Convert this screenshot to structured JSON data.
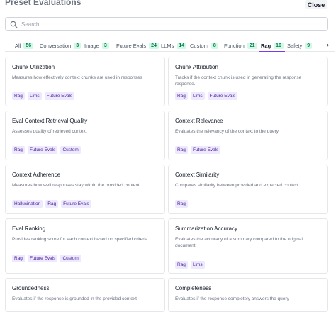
{
  "header": {
    "title": "Preset Evaluations",
    "close_label": "Close"
  },
  "search": {
    "placeholder": "Search",
    "value": ""
  },
  "tabs": [
    {
      "label": "All",
      "count": "56"
    },
    {
      "label": "Conversation",
      "count": "3"
    },
    {
      "label": "Image",
      "count": "3"
    },
    {
      "label": "Future Evals",
      "count": "24"
    },
    {
      "label": "LLMs",
      "count": "14"
    },
    {
      "label": "Custom",
      "count": "8"
    },
    {
      "label": "Function",
      "count": "21"
    },
    {
      "label": "Rag",
      "count": "10"
    },
    {
      "label": "Safety",
      "count": "9"
    }
  ],
  "active_tab": "Rag",
  "accent_color": "#7c3aed",
  "cards": [
    {
      "title": "Chunk Utilization",
      "desc": "Measures how effectively context chunks are used in responses",
      "tags": [
        "Rag",
        "Llms",
        "Future Evals"
      ]
    },
    {
      "title": "Chunk Attribution",
      "desc": "Tracks if the context chunk is used in generating the response response.",
      "tags": [
        "Rag",
        "Llms",
        "Future Evals"
      ]
    },
    {
      "title": "Eval Context Retrieval Quality",
      "desc": "Assesses quality of retrieved context",
      "tags": [
        "Rag",
        "Future Evals",
        "Custom"
      ]
    },
    {
      "title": "Context Relevance",
      "desc": "Evaluates the relevancy of the context to the query",
      "tags": [
        "Rag",
        "Future Evals"
      ]
    },
    {
      "title": "Context Adherence",
      "desc": "Measures how well responses stay within the provided context",
      "tags": [
        "Hallucination",
        "Rag",
        "Future Evals"
      ]
    },
    {
      "title": "Context Similarity",
      "desc": "Compares similarity between provided and expected context",
      "tags": [
        "Rag"
      ]
    },
    {
      "title": "Eval Ranking",
      "desc": "Provides ranking score for each context based on specified criteria",
      "tags": [
        "Rag",
        "Future Evals",
        "Custom"
      ]
    },
    {
      "title": "Summarization Accuracy",
      "desc": "Evaluates the accuracy of a summary compared to the original document",
      "tags": [
        "Rag",
        "Llms"
      ]
    },
    {
      "title": "Groundedness",
      "desc": "Evaluates if the response is grounded in the provided context",
      "tags": []
    },
    {
      "title": "Completeness",
      "desc": "Evaluates if the response completely answers the query",
      "tags": []
    }
  ]
}
